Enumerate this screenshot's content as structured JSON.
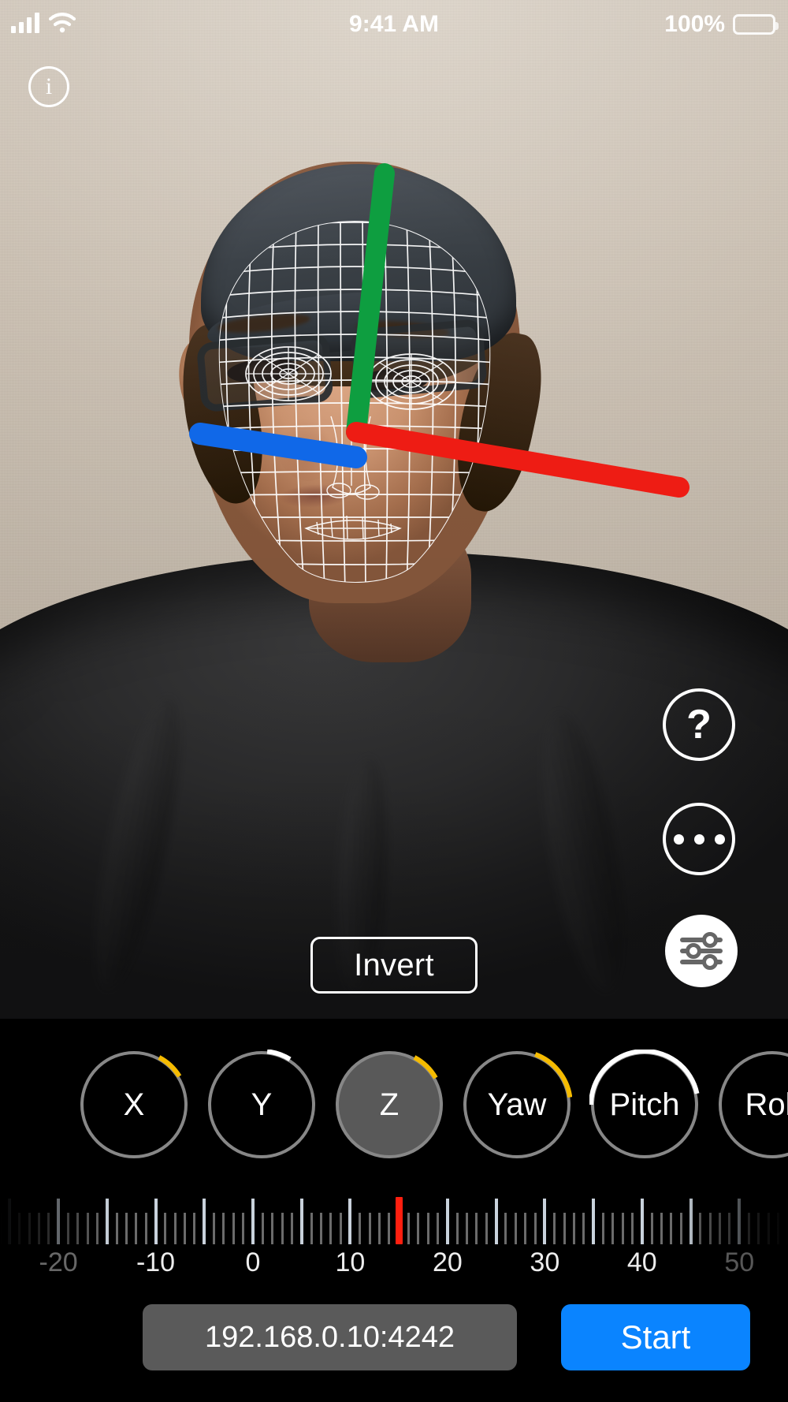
{
  "status_bar": {
    "time": "9:41 AM",
    "battery_percent": "100%",
    "signal_icon": "cellular-bars-icon",
    "wifi_icon": "wifi-icon",
    "battery_icon": "battery-icon"
  },
  "overlay": {
    "info_icon": "info-icon",
    "info_glyph": "i",
    "help_icon": "question-mark-icon",
    "help_glyph": "?",
    "more_icon": "ellipsis-icon",
    "settings_icon": "sliders-icon",
    "invert_label": "Invert"
  },
  "camera": {
    "axes": [
      {
        "name": "x-axis-arrow",
        "color": "#ee1c14",
        "direction": "right"
      },
      {
        "name": "y-axis-arrow",
        "color": "#0e9e40",
        "direction": "up"
      },
      {
        "name": "z-axis-arrow",
        "color": "#1068e8",
        "direction": "left"
      }
    ],
    "mesh_color": "#ffffff",
    "mesh_name": "face-mesh-wireframe"
  },
  "axis_buttons": [
    {
      "label": "X",
      "selected": false,
      "arc_color": "#f5bb00",
      "arc_start": -62,
      "arc_sweep": 30
    },
    {
      "label": "Y",
      "selected": false,
      "arc_color": "#ffffff",
      "arc_start": -84,
      "arc_sweep": 26
    },
    {
      "label": "Z",
      "selected": true,
      "arc_color": "#f5bb00",
      "arc_start": -62,
      "arc_sweep": 32
    },
    {
      "label": "Yaw",
      "selected": false,
      "arc_color": "#f5bb00",
      "arc_start": -70,
      "arc_sweep": 62
    },
    {
      "label": "Pitch",
      "selected": false,
      "arc_color": "#ffffff",
      "arc_start": -180,
      "arc_sweep": 168
    },
    {
      "label": "Roll",
      "selected": false,
      "arc_color": "#ffffff",
      "arc_start": 0,
      "arc_sweep": 0
    }
  ],
  "ruler": {
    "labels": [
      "-20",
      "-10",
      "0",
      "10",
      "20",
      "30",
      "40",
      "50"
    ],
    "values": [
      -20,
      -10,
      0,
      10,
      20,
      30,
      40,
      50
    ],
    "min": -26,
    "max": 55,
    "minor_step": 1,
    "major_step": 5,
    "needle_value": 15,
    "needle_color": "#ff1f0f"
  },
  "bottom": {
    "address_value": "192.168.0.10:4242",
    "address_placeholder": "192.168.0.10:4242",
    "start_label": "Start",
    "start_color": "#0a84ff"
  }
}
